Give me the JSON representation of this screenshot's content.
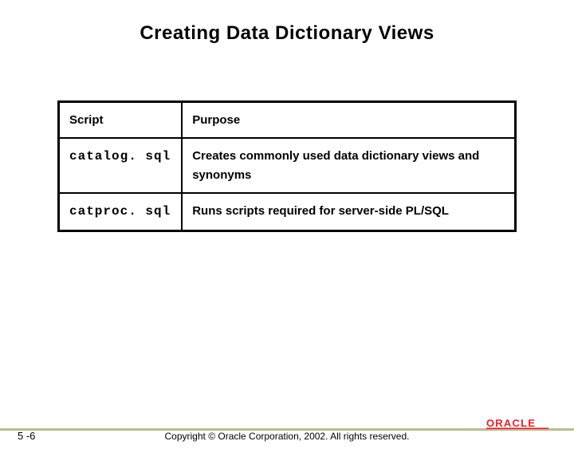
{
  "title": "Creating Data Dictionary Views",
  "table": {
    "headers": {
      "script": "Script",
      "purpose": "Purpose"
    },
    "rows": [
      {
        "script": "catalog. sql",
        "purpose": "Creates commonly used data dictionary views and synonyms"
      },
      {
        "script": "catproc. sql",
        "purpose": "Runs scripts required for server-side PL/SQL"
      }
    ]
  },
  "footer": {
    "slide_number": "5 -6",
    "copyright": "Copyright © Oracle Corporation, 2002. All rights reserved.",
    "logo_text": "ORACLE"
  }
}
